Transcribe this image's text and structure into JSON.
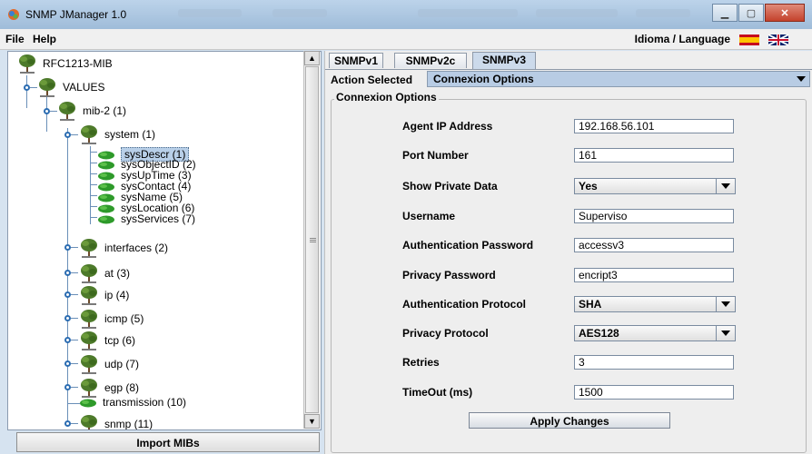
{
  "window": {
    "title": "SNMP JManager 1.0"
  },
  "menu": {
    "file": "File",
    "help": "Help",
    "language_label": "Idioma / Language"
  },
  "tree": {
    "root": "RFC1213-MIB",
    "values": "VALUES",
    "mib2": "mib-2 (1)",
    "system": "system (1)",
    "system_leaves": [
      "sysDescr (1)",
      "sysObjectID (2)",
      "sysUpTime (3)",
      "sysContact (4)",
      "sysName (5)",
      "sysLocation (6)",
      "sysServices (7)"
    ],
    "groups": [
      "interfaces (2)",
      "at (3)",
      "ip (4)",
      "icmp (5)",
      "tcp (6)",
      "udp (7)",
      "egp (8)",
      "transmission (10)",
      "snmp (11)"
    ]
  },
  "import_button": "Import MIBs",
  "tabs": [
    "SNMPv1",
    "SNMPv2c",
    "SNMPv3"
  ],
  "active_tab": "SNMPv3",
  "action": {
    "label": "Action Selected",
    "value": "Connexion Options"
  },
  "group_title": "Connexion Options",
  "fields": [
    {
      "label": "Agent IP Address",
      "value": "192.168.56.101",
      "type": "text"
    },
    {
      "label": "Port Number",
      "value": "161",
      "type": "text"
    },
    {
      "label": "Show Private Data",
      "value": "Yes",
      "type": "select"
    },
    {
      "label": "Username",
      "value": "Superviso",
      "type": "text"
    },
    {
      "label": "Authentication Password",
      "value": "accessv3",
      "type": "text"
    },
    {
      "label": "Privacy Password",
      "value": "encript3",
      "type": "text"
    },
    {
      "label": "Authentication Protocol",
      "value": "SHA",
      "type": "select"
    },
    {
      "label": "Privacy Protocol",
      "value": "AES128",
      "type": "select"
    },
    {
      "label": "Retries",
      "value": "3",
      "type": "text"
    },
    {
      "label": "TimeOut (ms)",
      "value": "1500",
      "type": "text"
    }
  ],
  "apply_button": "Apply Changes"
}
